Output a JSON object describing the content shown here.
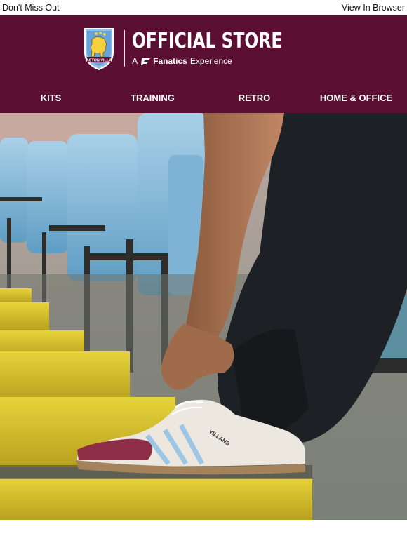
{
  "topbar": {
    "left_text": "Don't Miss Out",
    "right_link": "View In Browser"
  },
  "header": {
    "crest_text": "ASTON VILLA",
    "store_title": "OFFICIAL STORE",
    "sub_prefix": "A",
    "sub_brand": "Fanatics",
    "sub_suffix": "Experience",
    "background_color": "#5a0f33"
  },
  "nav": {
    "items": [
      {
        "label": "KITS"
      },
      {
        "label": "TRAINING"
      },
      {
        "label": "RETRO"
      },
      {
        "label": "HOME & OFFICE"
      }
    ]
  },
  "hero": {
    "shoe_text": "VILLANS",
    "icons": [
      "sneaker-photo"
    ]
  },
  "colors": {
    "claret": "#5a0f33",
    "sky_blue": "#8ec3e0",
    "stair_yellow": "#d9c32c"
  }
}
